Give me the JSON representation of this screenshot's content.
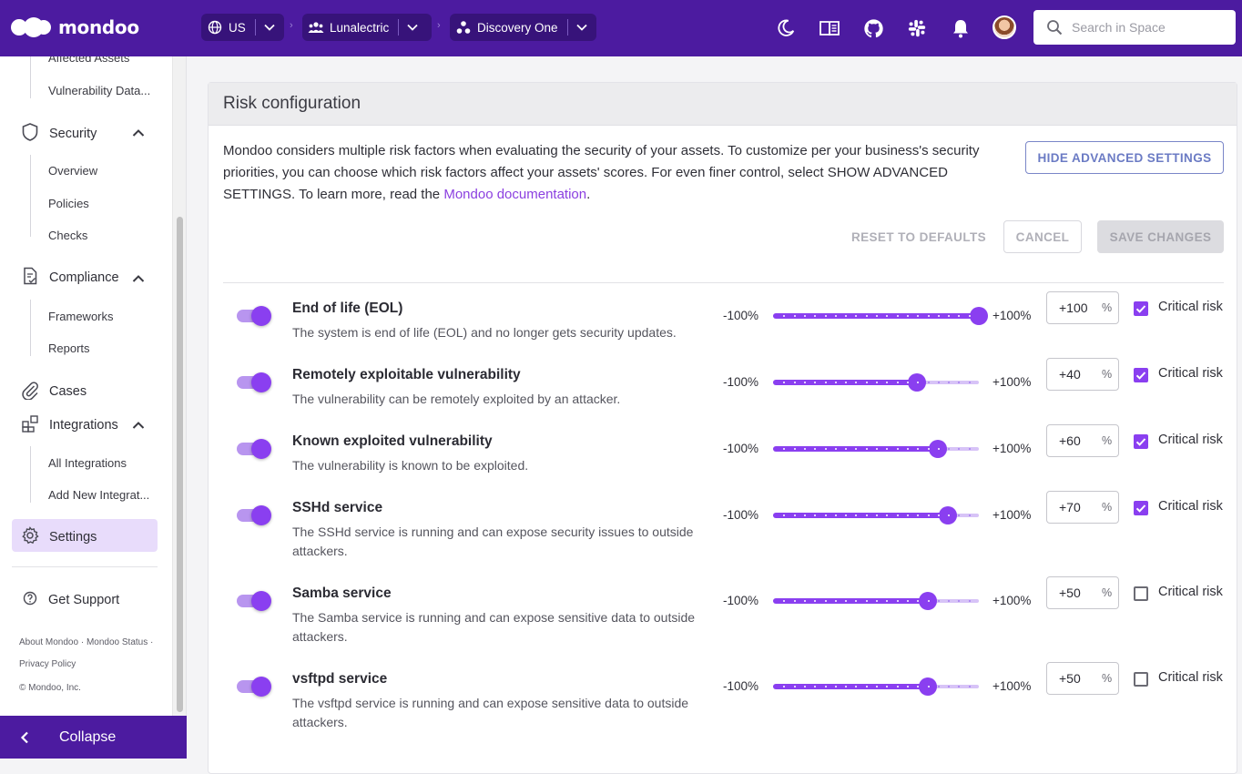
{
  "brand": {
    "name": "mondoo"
  },
  "topbar": {
    "crumbs": [
      {
        "label": "US"
      },
      {
        "label": "Lunalectric"
      },
      {
        "label": "Discovery One"
      }
    ],
    "search_placeholder": "Search in Space"
  },
  "sidebar": {
    "vuln_items": [
      "Affected Assets",
      "Vulnerability Data..."
    ],
    "security": {
      "label": "Security",
      "items": [
        "Overview",
        "Policies",
        "Checks"
      ]
    },
    "compliance": {
      "label": "Compliance",
      "items": [
        "Frameworks",
        "Reports"
      ]
    },
    "cases": {
      "label": "Cases"
    },
    "integrations": {
      "label": "Integrations",
      "items": [
        "All Integrations",
        "Add New Integrat..."
      ]
    },
    "settings": {
      "label": "Settings"
    },
    "support": {
      "label": "Get Support"
    },
    "footer": {
      "about": "About Mondoo",
      "status": "Mondoo Status",
      "privacy": "Privacy Policy",
      "copyright": "© Mondoo, Inc."
    },
    "collapse": "Collapse"
  },
  "main": {
    "title": "Risk configuration",
    "description_pre": "Mondoo considers multiple risk factors when evaluating the security of your assets. To customize per your business's security priorities, you can choose which risk factors affect your assets' scores. For even finer control, select SHOW ADVANCED SETTINGS. To learn more, read the ",
    "description_link": "Mondoo documentation",
    "description_post": ".",
    "btn_advanced": "HIDE ADVANCED SETTINGS",
    "btn_reset": "RESET TO DEFAULTS",
    "btn_cancel": "CANCEL",
    "btn_save": "SAVE CHANGES",
    "slider_min": "-100%",
    "slider_max": "+100%",
    "percent_unit": "%",
    "critical_label": "Critical risk",
    "factors": [
      {
        "title": "End of life (EOL)",
        "desc": "The system is end of life (EOL) and no longer gets security updates.",
        "enabled": true,
        "value": 100,
        "display": "+100",
        "critical": true
      },
      {
        "title": "Remotely exploitable vulnerability",
        "desc": "The vulnerability can be remotely exploited by an attacker.",
        "enabled": true,
        "value": 40,
        "display": "+40",
        "critical": true
      },
      {
        "title": "Known exploited vulnerability",
        "desc": "The vulnerability is known to be exploited.",
        "enabled": true,
        "value": 60,
        "display": "+60",
        "critical": true
      },
      {
        "title": "SSHd service",
        "desc": "The SSHd service is running and can expose security issues to outside attackers.",
        "enabled": true,
        "value": 70,
        "display": "+70",
        "critical": true
      },
      {
        "title": "Samba service",
        "desc": "The Samba service is running and can expose sensitive data to outside attackers.",
        "enabled": true,
        "value": 50,
        "display": "+50",
        "critical": false
      },
      {
        "title": "vsftpd service",
        "desc": "The vsftpd service is running and can expose sensitive data to outside attackers.",
        "enabled": true,
        "value": 50,
        "display": "+50",
        "critical": false
      }
    ]
  },
  "colors": {
    "brand": "#4c1ba0",
    "accent": "#8a3ff0"
  }
}
